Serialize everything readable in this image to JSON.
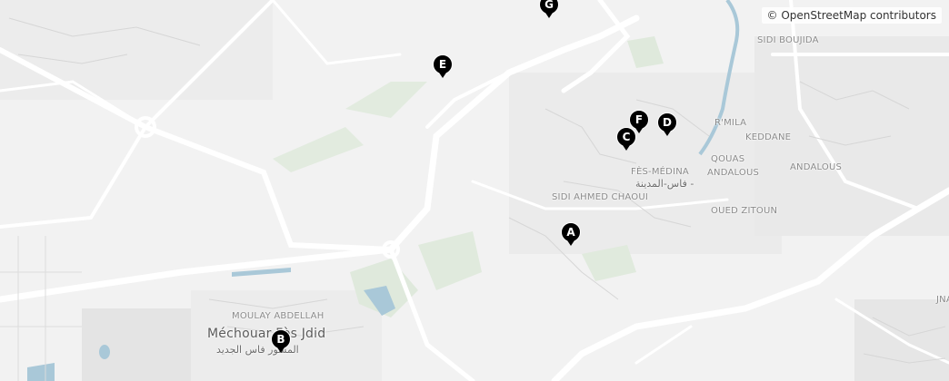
{
  "attribution": "© OpenStreetMap contributors",
  "places": {
    "sidi_boujida": "SIDI BOUJIDA",
    "rmila": "R'MILA",
    "keddane": "KEDDANE",
    "fes_medina": "FÈS-MÉDINA",
    "fes_medina_ar": "فاس-المدينة -",
    "qouas": "QOUAS",
    "andalous_upper": "ANDALOUS",
    "andalous": "ANDALOUS",
    "sidi_ahmed_chaoui": "SIDI AHMED CHAOUI",
    "oued_zitoun": "OUED ZITOUN",
    "moulay_abdellah": "MOULAY ABDELLAH",
    "mechouar": "Méchouar Fès Jdid",
    "mechouar_ar": "المشور فاس الجديد",
    "jna": "JNA"
  },
  "markers": [
    {
      "id": "A",
      "label": "A"
    },
    {
      "id": "B",
      "label": "B"
    },
    {
      "id": "C",
      "label": "C"
    },
    {
      "id": "D",
      "label": "D"
    },
    {
      "id": "E",
      "label": "E"
    },
    {
      "id": "F",
      "label": "F"
    },
    {
      "id": "G",
      "label": "G"
    }
  ],
  "colors": {
    "background": "#f2f2f2",
    "roads": "#ffffff",
    "green": "#dfe9dc",
    "water": "#a9c8d8",
    "marker": "#000000"
  }
}
